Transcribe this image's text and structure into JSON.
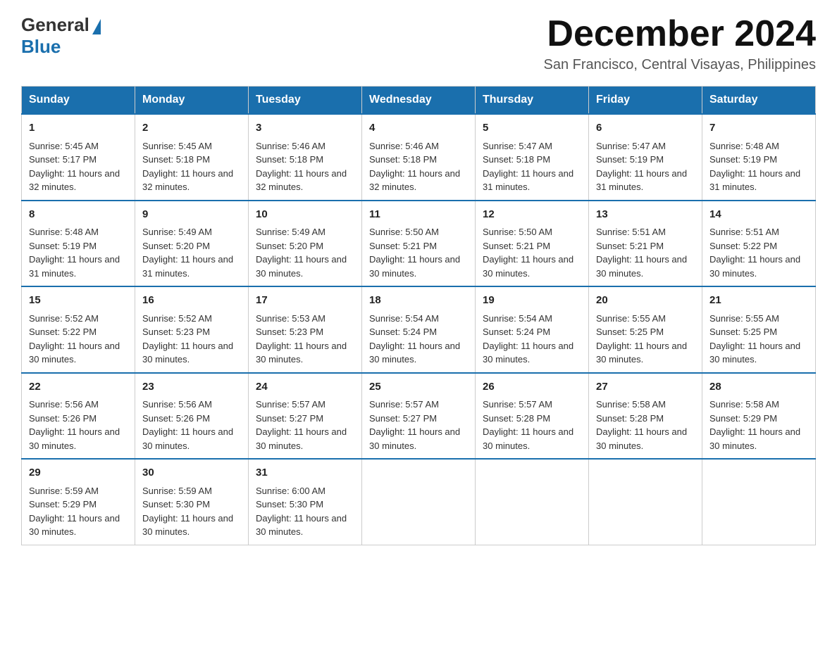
{
  "logo": {
    "general": "General",
    "blue": "Blue"
  },
  "title": "December 2024",
  "location": "San Francisco, Central Visayas, Philippines",
  "days_of_week": [
    "Sunday",
    "Monday",
    "Tuesday",
    "Wednesday",
    "Thursday",
    "Friday",
    "Saturday"
  ],
  "weeks": [
    [
      {
        "day": "1",
        "sunrise": "5:45 AM",
        "sunset": "5:17 PM",
        "daylight": "11 hours and 32 minutes."
      },
      {
        "day": "2",
        "sunrise": "5:45 AM",
        "sunset": "5:18 PM",
        "daylight": "11 hours and 32 minutes."
      },
      {
        "day": "3",
        "sunrise": "5:46 AM",
        "sunset": "5:18 PM",
        "daylight": "11 hours and 32 minutes."
      },
      {
        "day": "4",
        "sunrise": "5:46 AM",
        "sunset": "5:18 PM",
        "daylight": "11 hours and 32 minutes."
      },
      {
        "day": "5",
        "sunrise": "5:47 AM",
        "sunset": "5:18 PM",
        "daylight": "11 hours and 31 minutes."
      },
      {
        "day": "6",
        "sunrise": "5:47 AM",
        "sunset": "5:19 PM",
        "daylight": "11 hours and 31 minutes."
      },
      {
        "day": "7",
        "sunrise": "5:48 AM",
        "sunset": "5:19 PM",
        "daylight": "11 hours and 31 minutes."
      }
    ],
    [
      {
        "day": "8",
        "sunrise": "5:48 AM",
        "sunset": "5:19 PM",
        "daylight": "11 hours and 31 minutes."
      },
      {
        "day": "9",
        "sunrise": "5:49 AM",
        "sunset": "5:20 PM",
        "daylight": "11 hours and 31 minutes."
      },
      {
        "day": "10",
        "sunrise": "5:49 AM",
        "sunset": "5:20 PM",
        "daylight": "11 hours and 30 minutes."
      },
      {
        "day": "11",
        "sunrise": "5:50 AM",
        "sunset": "5:21 PM",
        "daylight": "11 hours and 30 minutes."
      },
      {
        "day": "12",
        "sunrise": "5:50 AM",
        "sunset": "5:21 PM",
        "daylight": "11 hours and 30 minutes."
      },
      {
        "day": "13",
        "sunrise": "5:51 AM",
        "sunset": "5:21 PM",
        "daylight": "11 hours and 30 minutes."
      },
      {
        "day": "14",
        "sunrise": "5:51 AM",
        "sunset": "5:22 PM",
        "daylight": "11 hours and 30 minutes."
      }
    ],
    [
      {
        "day": "15",
        "sunrise": "5:52 AM",
        "sunset": "5:22 PM",
        "daylight": "11 hours and 30 minutes."
      },
      {
        "day": "16",
        "sunrise": "5:52 AM",
        "sunset": "5:23 PM",
        "daylight": "11 hours and 30 minutes."
      },
      {
        "day": "17",
        "sunrise": "5:53 AM",
        "sunset": "5:23 PM",
        "daylight": "11 hours and 30 minutes."
      },
      {
        "day": "18",
        "sunrise": "5:54 AM",
        "sunset": "5:24 PM",
        "daylight": "11 hours and 30 minutes."
      },
      {
        "day": "19",
        "sunrise": "5:54 AM",
        "sunset": "5:24 PM",
        "daylight": "11 hours and 30 minutes."
      },
      {
        "day": "20",
        "sunrise": "5:55 AM",
        "sunset": "5:25 PM",
        "daylight": "11 hours and 30 minutes."
      },
      {
        "day": "21",
        "sunrise": "5:55 AM",
        "sunset": "5:25 PM",
        "daylight": "11 hours and 30 minutes."
      }
    ],
    [
      {
        "day": "22",
        "sunrise": "5:56 AM",
        "sunset": "5:26 PM",
        "daylight": "11 hours and 30 minutes."
      },
      {
        "day": "23",
        "sunrise": "5:56 AM",
        "sunset": "5:26 PM",
        "daylight": "11 hours and 30 minutes."
      },
      {
        "day": "24",
        "sunrise": "5:57 AM",
        "sunset": "5:27 PM",
        "daylight": "11 hours and 30 minutes."
      },
      {
        "day": "25",
        "sunrise": "5:57 AM",
        "sunset": "5:27 PM",
        "daylight": "11 hours and 30 minutes."
      },
      {
        "day": "26",
        "sunrise": "5:57 AM",
        "sunset": "5:28 PM",
        "daylight": "11 hours and 30 minutes."
      },
      {
        "day": "27",
        "sunrise": "5:58 AM",
        "sunset": "5:28 PM",
        "daylight": "11 hours and 30 minutes."
      },
      {
        "day": "28",
        "sunrise": "5:58 AM",
        "sunset": "5:29 PM",
        "daylight": "11 hours and 30 minutes."
      }
    ],
    [
      {
        "day": "29",
        "sunrise": "5:59 AM",
        "sunset": "5:29 PM",
        "daylight": "11 hours and 30 minutes."
      },
      {
        "day": "30",
        "sunrise": "5:59 AM",
        "sunset": "5:30 PM",
        "daylight": "11 hours and 30 minutes."
      },
      {
        "day": "31",
        "sunrise": "6:00 AM",
        "sunset": "5:30 PM",
        "daylight": "11 hours and 30 minutes."
      },
      null,
      null,
      null,
      null
    ]
  ],
  "labels": {
    "sunrise": "Sunrise:",
    "sunset": "Sunset:",
    "daylight": "Daylight:"
  }
}
